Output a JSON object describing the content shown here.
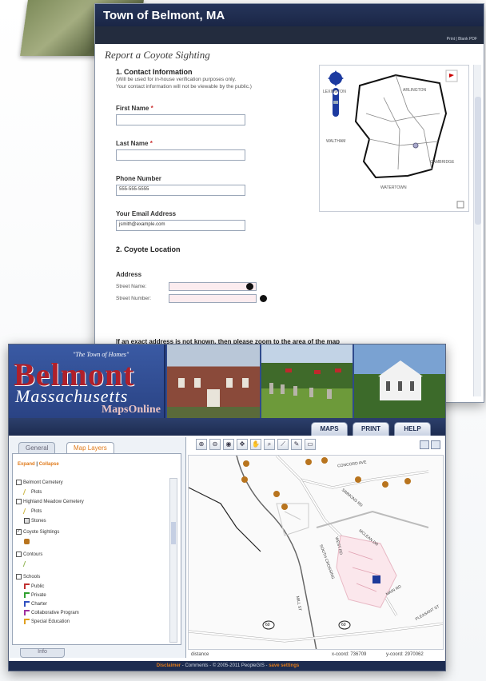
{
  "form": {
    "header_title": "Town of Belmont, MA",
    "header_links": "Print | Blank PDF",
    "page_title": "Report a Coyote Sighting",
    "section1_heading": "1. Contact Information",
    "section1_note_1": "(Will be used for in-house verification purposes only.",
    "section1_note_2": "Your contact information will not be viewable by the public.)",
    "first_name_label": "First Name",
    "last_name_label": "Last Name",
    "required_mark": "*",
    "phone_label": "Phone Number",
    "phone_value": "555-555-5555",
    "email_label": "Your Email Address",
    "email_value": "jsmith@example.com",
    "section2_heading": "2. Coyote Location",
    "address_heading": "Address",
    "street_name_label": "Street Name:",
    "street_number_label": "Street Number:",
    "cut_text": "If an exact address is not known, then please zoom to the area of the map"
  },
  "mini_map": {
    "labels": [
      "ARLINGTON",
      "WALTHAM",
      "CAMBRIDGE",
      "WATERTOWN",
      "LEXINGTON"
    ]
  },
  "maps": {
    "logo_tagline": "\"The Town of Homes\"",
    "logo_main": "Belmont",
    "logo_sub": "Massachusetts",
    "logo_mapsonline": "MapsOnline",
    "nav_tabs": [
      "MAPS",
      "PRINT",
      "HELP"
    ],
    "panel_tabs": [
      "General",
      "Map Layers"
    ],
    "expand_label": "Expand",
    "collapse_label": "Collapse",
    "layers": [
      {
        "label": "Belmont Cemetery",
        "checked": false
      },
      {
        "label": "Plots",
        "checked": null
      },
      {
        "label": "Highland Meadow Cemetery",
        "checked": false
      },
      {
        "label": "Plots",
        "checked": null
      },
      {
        "label": "Stones",
        "checked": null
      },
      {
        "label": "Coyote Sightings",
        "checked": true
      },
      {
        "label": "Contours",
        "checked": false
      },
      {
        "label": "Schools",
        "checked": false
      },
      {
        "label": "Public",
        "checked": null
      },
      {
        "label": "Private",
        "checked": null
      },
      {
        "label": "Charter",
        "checked": null
      },
      {
        "label": "Collaborative Program",
        "checked": null
      },
      {
        "label": "Special Education",
        "checked": null
      }
    ],
    "info_tab": "Info",
    "map_labels": [
      "CONCORD AVE",
      "SIMMONS RD",
      "MCLEAN DR",
      "SOUTH CROSSING",
      "WEST RD",
      "MILL ST",
      "MAIN RD",
      "PLEASANT ST"
    ],
    "route_shield": "60",
    "status_left": "distance",
    "xcoord": "x-coord: 736709",
    "ycoord": "y-coord: 2970062",
    "footer_disclaimer": "Disclaimer",
    "footer_comments": "Comments",
    "footer_copyright": "© 2005-2011 PeopleGIS",
    "footer_save": "save settings",
    "footer_sep": "-",
    "colors": {
      "brand_red": "#b0202a",
      "nav_blue": "#1d2c50",
      "accent_orange": "#e07a1a"
    }
  }
}
